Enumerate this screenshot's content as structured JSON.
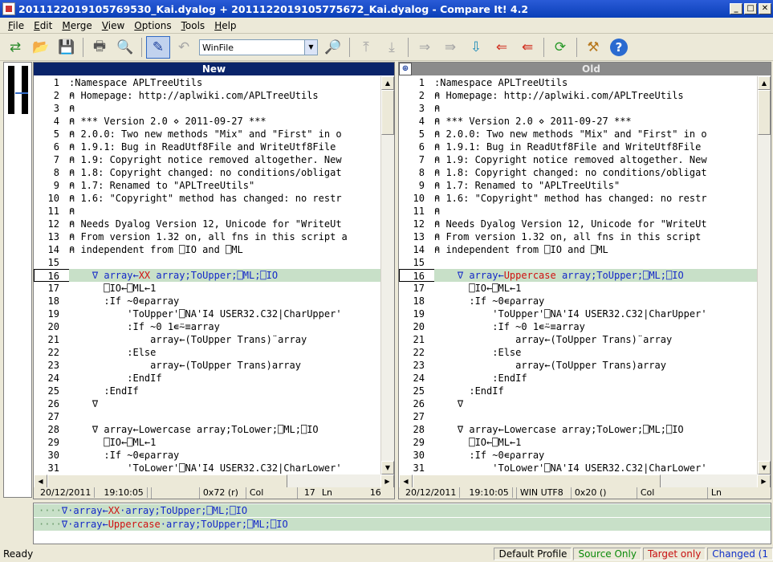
{
  "window": {
    "title": "2011122019105769530_Kai.dyalog + 2011122019105775672_Kai.dyalog - Compare It! 4.2",
    "minimize": "_",
    "maximize": "□",
    "close": "✕"
  },
  "menu": [
    "File",
    "Edit",
    "Merge",
    "View",
    "Options",
    "Tools",
    "Help"
  ],
  "toolbar": {
    "encoding_combo": "WinFile"
  },
  "left_pane": {
    "header": "New",
    "lines": [
      {
        "n": "1",
        "t": ":Namespace APLTreeUtils"
      },
      {
        "n": "2",
        "t": "⍝ Homepage: http://aplwiki.com/APLTreeUtils"
      },
      {
        "n": "3",
        "t": "⍝"
      },
      {
        "n": "4",
        "t": "⍝ *** Version 2.0 ⋄ 2011-09-27 ***"
      },
      {
        "n": "5",
        "t": "⍝ 2.0.0: Two new methods \"Mix\" and \"First\" in o"
      },
      {
        "n": "6",
        "t": "⍝ 1.9.1: Bug in ReadUtf8File and WriteUtf8File"
      },
      {
        "n": "7",
        "t": "⍝ 1.9: Copyright notice removed altogether. New"
      },
      {
        "n": "8",
        "t": "⍝ 1.8: Copyright changed: no conditions/obligat"
      },
      {
        "n": "9",
        "t": "⍝ 1.7: Renamed to \"APLTreeUtils\""
      },
      {
        "n": "10",
        "t": "⍝ 1.6: \"Copyright\" method has changed: no restr"
      },
      {
        "n": "11",
        "t": "⍝"
      },
      {
        "n": "12",
        "t": "⍝ Needs Dyalog Version 12, Unicode for \"WriteUt"
      },
      {
        "n": "13",
        "t": "⍝ From version 1.32 on, all fns in this script a"
      },
      {
        "n": "14",
        "t": "⍝ independent from ⎕IO and ⎕ML"
      },
      {
        "n": "15",
        "t": ""
      },
      {
        "n": "16",
        "t": "    ∇ array←XX array;ToUpper;⎕ML;⎕IO"
      },
      {
        "n": "17",
        "t": "      ⎕IO←⎕ML←1"
      },
      {
        "n": "18",
        "t": "      :If ~0∊⍴array"
      },
      {
        "n": "19",
        "t": "          'ToUpper'⎕NA'I4 USER32.C32|CharUpper'"
      },
      {
        "n": "20",
        "t": "          :If ~0 1∊⍨≡array"
      },
      {
        "n": "21",
        "t": "              array←(ToUpper Trans)¨array"
      },
      {
        "n": "22",
        "t": "          :Else"
      },
      {
        "n": "23",
        "t": "              array←(ToUpper Trans)array"
      },
      {
        "n": "24",
        "t": "          :EndIf"
      },
      {
        "n": "25",
        "t": "      :EndIf"
      },
      {
        "n": "26",
        "t": "    ∇"
      },
      {
        "n": "27",
        "t": ""
      },
      {
        "n": "28",
        "t": "    ∇ array←Lowercase array;ToLower;⎕ML;⎕IO"
      },
      {
        "n": "29",
        "t": "      ⎕IO←⎕ML←1"
      },
      {
        "n": "30",
        "t": "      :If ~0∊⍴array"
      },
      {
        "n": "31",
        "t": "          'ToLower'⎕NA'I4 USER32.C32|CharLower'"
      }
    ],
    "diff_line": {
      "n": "16",
      "pre": "    ∇ array←",
      "hl": "XX",
      "post": " array;ToUpper;⎕ML;⎕IO"
    },
    "status": {
      "date": "20/12/2011",
      "time": "19:10:05",
      "char": "0x72 (r)",
      "col_label": "Col",
      "col": "17",
      "ln_label": "Ln",
      "ln": "16"
    }
  },
  "right_pane": {
    "header": "Old",
    "lines": [
      {
        "n": "1",
        "t": ":Namespace APLTreeUtils"
      },
      {
        "n": "2",
        "t": "⍝ Homepage: http://aplwiki.com/APLTreeUtils"
      },
      {
        "n": "3",
        "t": "⍝"
      },
      {
        "n": "4",
        "t": "⍝ *** Version 2.0 ⋄ 2011-09-27 ***"
      },
      {
        "n": "5",
        "t": "⍝ 2.0.0: Two new methods \"Mix\" and \"First\" in o"
      },
      {
        "n": "6",
        "t": "⍝ 1.9.1: Bug in ReadUtf8File and WriteUtf8File"
      },
      {
        "n": "7",
        "t": "⍝ 1.9: Copyright notice removed altogether. New"
      },
      {
        "n": "8",
        "t": "⍝ 1.8: Copyright changed: no conditions/obligat"
      },
      {
        "n": "9",
        "t": "⍝ 1.7: Renamed to \"APLTreeUtils\""
      },
      {
        "n": "10",
        "t": "⍝ 1.6: \"Copyright\" method has changed: no restr"
      },
      {
        "n": "11",
        "t": "⍝"
      },
      {
        "n": "12",
        "t": "⍝ Needs Dyalog Version 12, Unicode for \"WriteUt"
      },
      {
        "n": "13",
        "t": "⍝ From version 1.32 on, all fns in this script"
      },
      {
        "n": "14",
        "t": "⍝ independent from ⎕IO and ⎕ML"
      },
      {
        "n": "15",
        "t": ""
      },
      {
        "n": "16",
        "t": "    ∇ array←Uppercase array;ToUpper;⎕ML;⎕IO"
      },
      {
        "n": "17",
        "t": "      ⎕IO←⎕ML←1"
      },
      {
        "n": "18",
        "t": "      :If ~0∊⍴array"
      },
      {
        "n": "19",
        "t": "          'ToUpper'⎕NA'I4 USER32.C32|CharUpper'"
      },
      {
        "n": "20",
        "t": "          :If ~0 1∊⍨≡array"
      },
      {
        "n": "21",
        "t": "              array←(ToUpper Trans)¨array"
      },
      {
        "n": "22",
        "t": "          :Else"
      },
      {
        "n": "23",
        "t": "              array←(ToUpper Trans)array"
      },
      {
        "n": "24",
        "t": "          :EndIf"
      },
      {
        "n": "25",
        "t": "      :EndIf"
      },
      {
        "n": "26",
        "t": "    ∇"
      },
      {
        "n": "27",
        "t": ""
      },
      {
        "n": "28",
        "t": "    ∇ array←Lowercase array;ToLower;⎕ML;⎕IO"
      },
      {
        "n": "29",
        "t": "      ⎕IO←⎕ML←1"
      },
      {
        "n": "30",
        "t": "      :If ~0∊⍴array"
      },
      {
        "n": "31",
        "t": "          'ToLower'⎕NA'I4 USER32.C32|CharLower'"
      }
    ],
    "diff_line": {
      "n": "16",
      "pre": "    ∇ array←",
      "hl": "Uppercase",
      "post": " array;ToUpper;⎕ML;⎕IO"
    },
    "status": {
      "date": "20/12/2011",
      "time": "19:10:05",
      "enc": "WIN UTF8",
      "char": "0x20 ()",
      "col_label": "Col",
      "ln_label": "Ln"
    }
  },
  "comparison": {
    "new_line": {
      "dots": "····",
      "pre": "∇·array←",
      "hl": "XX",
      "post": "·array;ToUpper;⎕ML;⎕IO"
    },
    "old_line": {
      "dots": "····",
      "pre": "∇·array←",
      "hl": "Uppercase",
      "post": "·array;ToUpper;⎕ML;⎕IO"
    }
  },
  "statusbar": {
    "ready": "Ready",
    "profile": "Default Profile",
    "source_only": "Source Only",
    "target_only": "Target only",
    "changed": "Changed (1"
  },
  "colors": {
    "title_bar": "#0a3fb8",
    "diff_bg": "#c8e0c8",
    "diff_text": "#1428c8",
    "diff_highlight": "#d01010",
    "left_header": "#0a246a",
    "right_header": "#8b8b8b"
  }
}
